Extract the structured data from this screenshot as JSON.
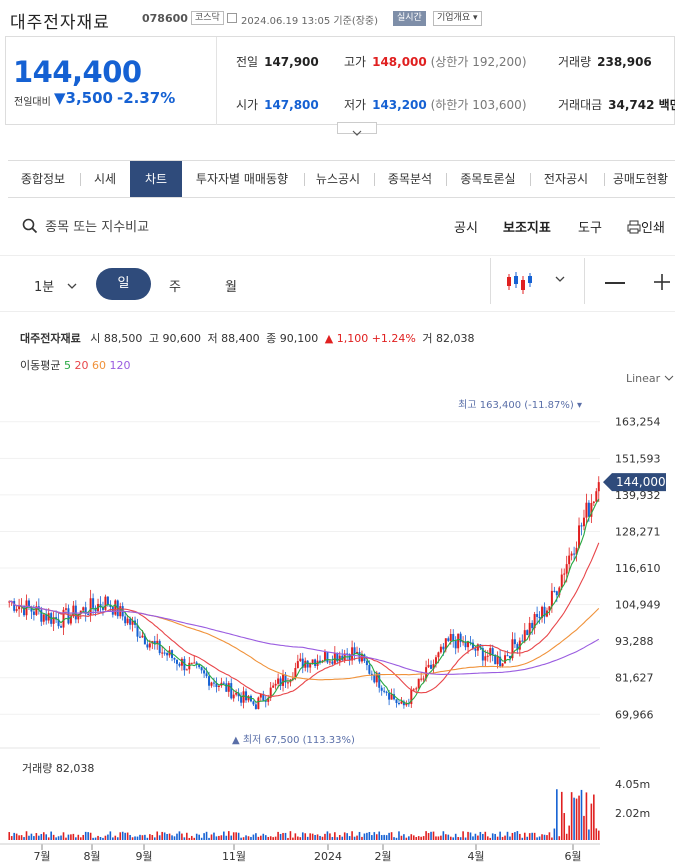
{
  "header": {
    "stock_name": "대주전자재료",
    "code": "078600",
    "market": "코스닥",
    "datetime": "2024.06.19 13:05 기준(장중)",
    "realtime": "실시간",
    "company_info": "기업개요"
  },
  "summary": {
    "price": "144,400",
    "change_label": "전일대비",
    "change_value": "3,500",
    "change_pct": "-2.37%",
    "prev_close_label": "전일",
    "prev_close": "147,900",
    "high_label": "고가",
    "high": "148,000",
    "upper_limit": "(상한가 192,200)",
    "volume_label": "거래량",
    "volume": "238,906",
    "open_label": "시가",
    "open": "147,800",
    "low_label": "저가",
    "low": "143,200",
    "lower_limit": "(하한가 103,600)",
    "amount_label": "거래대금",
    "amount": "34,742 백만"
  },
  "tabs": [
    "종합정보",
    "시세",
    "차트",
    "투자자별 매매동향",
    "뉴스공시",
    "종목분석",
    "종목토론실",
    "전자공시",
    "공매도현황"
  ],
  "toolbar": {
    "search_placeholder": "종목 또는 지수비교",
    "disclosure": "공시",
    "indicators": "보조지표",
    "tools": "도구",
    "print": "인쇄"
  },
  "periods": {
    "minute": "1분",
    "day": "일",
    "week": "주",
    "month": "월"
  },
  "chart_info": {
    "name": "대주전자재료",
    "open_label": "시",
    "open": "88,500",
    "high_label": "고",
    "high": "90,600",
    "low_label": "저",
    "low": "88,400",
    "close_label": "종",
    "close": "90,100",
    "change": "1,100",
    "change_pct": "+1.24%",
    "volume_label": "거",
    "volume": "82,038",
    "ma_label": "이동평균",
    "ma": [
      "5",
      "20",
      "60",
      "120"
    ],
    "scale": "Linear",
    "volume_panel_label": "거래량 82,038"
  },
  "colors": {
    "up": "#e02020",
    "down": "#1561d3",
    "accent": "#2f4b7b",
    "ma5": "#27a843",
    "ma20": "#e8464a",
    "ma60": "#f0923a",
    "ma120": "#9a5ce0"
  },
  "chart_data": {
    "type": "candlestick",
    "y_ticks": [
      "163,254",
      "151,593",
      "139,932",
      "128,271",
      "116,610",
      "104,949",
      "93,288",
      "81,627",
      "69,966"
    ],
    "ylim": [
      64000,
      167000
    ],
    "x_ticks": [
      "7월",
      "8월",
      "9월",
      "11월",
      "2024",
      "2월",
      "4월",
      "6월"
    ],
    "current_price_tag": "144,000",
    "max_annotation": "최고 163,400 (-11.87%)",
    "min_annotation": "최저 67,500 (113.33%)",
    "volume_ticks": [
      "4.05m",
      "2.02m"
    ],
    "series_close": [
      {
        "m": "2023-06",
        "v": 106000
      },
      {
        "m": "2023-07",
        "v": 100000
      },
      {
        "m": "2023-08",
        "v": 106000
      },
      {
        "m": "2023-09",
        "v": 91000
      },
      {
        "m": "2023-10",
        "v": 82000
      },
      {
        "m": "2023-11",
        "v": 73000
      },
      {
        "m": "2023-12",
        "v": 87000
      },
      {
        "m": "2024-01",
        "v": 90000
      },
      {
        "m": "2024-02",
        "v": 72000
      },
      {
        "m": "2024-03",
        "v": 94000
      },
      {
        "m": "2024-04",
        "v": 87000
      },
      {
        "m": "2024-05",
        "v": 105000
      },
      {
        "m": "2024-06",
        "v": 144000
      }
    ]
  }
}
